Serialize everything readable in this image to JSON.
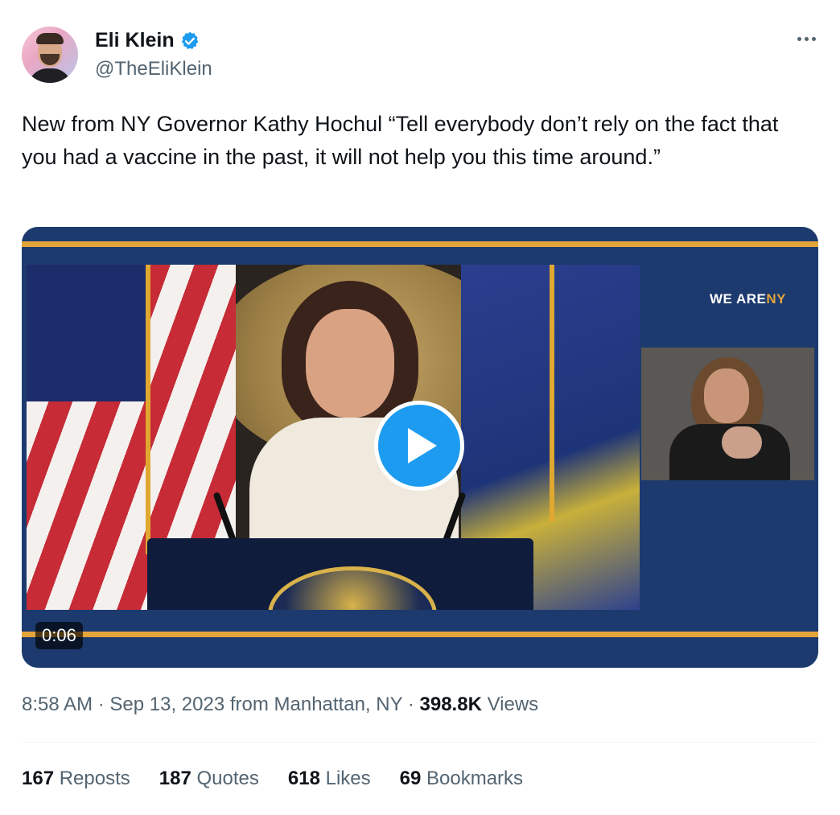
{
  "author": {
    "name": "Eli Klein",
    "handle": "@TheEliKlein",
    "verified": true,
    "verified_color": "#1d9bf0"
  },
  "tweet": {
    "text": "New from NY Governor Kathy Hochul “Tell everybody don’t rely on the fact that you had a vaccine in the past, it will not help you this time around.”"
  },
  "media": {
    "type": "video",
    "duration": "0:06",
    "overlay_logo": {
      "prefix": "WE ARE",
      "suffix": "NY"
    }
  },
  "meta": {
    "time": "8:58 AM",
    "separator": " · ",
    "date_location": "Sep 13, 2023 from Manhattan, NY",
    "views_count": "398.8K",
    "views_label": "Views"
  },
  "stats": [
    {
      "count": "167",
      "label": "Reposts"
    },
    {
      "count": "187",
      "label": "Quotes"
    },
    {
      "count": "618",
      "label": "Likes"
    },
    {
      "count": "69",
      "label": "Bookmarks"
    }
  ],
  "icons": [
    "verified-badge-icon",
    "more-options-icon",
    "play-icon"
  ],
  "colors": {
    "accent": "#1d9bf0",
    "text": "#0f1419",
    "secondary": "#536471"
  }
}
